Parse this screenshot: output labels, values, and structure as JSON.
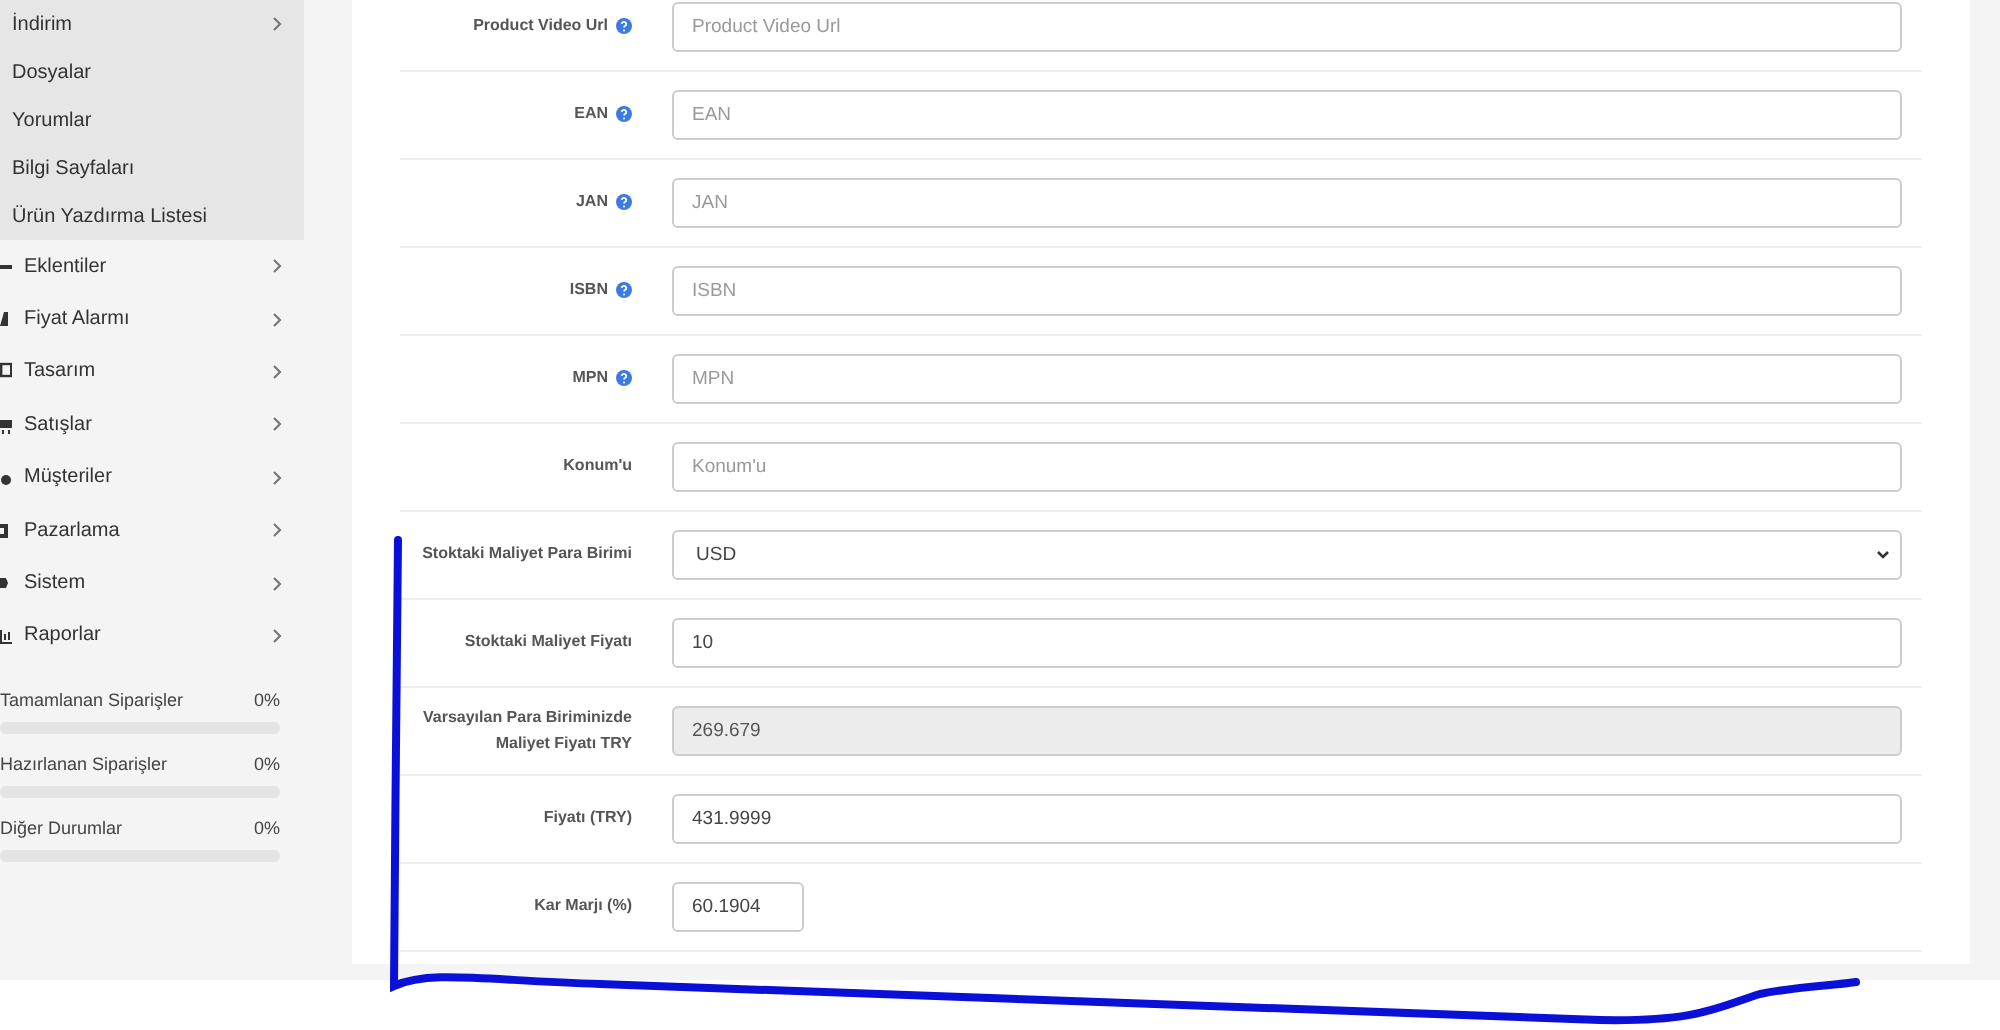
{
  "sidebar": {
    "submenu": [
      {
        "label": "İndirim",
        "has_arrow": true
      },
      {
        "label": "Dosyalar",
        "has_arrow": false
      },
      {
        "label": "Yorumlar",
        "has_arrow": false
      },
      {
        "label": "Bilgi Sayfaları",
        "has_arrow": false
      },
      {
        "label": "Ürün Yazdırma Listesi",
        "has_arrow": false
      }
    ],
    "menu": [
      {
        "label": "Eklentiler"
      },
      {
        "label": "Fiyat Alarmı"
      },
      {
        "label": "Tasarım"
      },
      {
        "label": "Satışlar"
      },
      {
        "label": "Müşteriler"
      },
      {
        "label": "Pazarlama"
      },
      {
        "label": "Sistem"
      },
      {
        "label": "Raporlar"
      }
    ],
    "stats": [
      {
        "label": "Tamamlanan Siparişler",
        "value": "0%",
        "level": 0
      },
      {
        "label": "Hazırlanan Siparişler",
        "value": "0%",
        "level": 0
      },
      {
        "label": "Diğer Durumlar",
        "value": "0%",
        "level": 0
      }
    ]
  },
  "form": {
    "rows": [
      {
        "label": "Product Video Url",
        "help": true,
        "kind": "input",
        "placeholder": "Product Video Url",
        "disabled": false
      },
      {
        "label": "EAN",
        "help": true,
        "kind": "input",
        "placeholder": "EAN",
        "disabled": false
      },
      {
        "label": "JAN",
        "help": true,
        "kind": "input",
        "placeholder": "JAN",
        "disabled": false
      },
      {
        "label": "ISBN",
        "help": true,
        "kind": "input",
        "placeholder": "ISBN",
        "disabled": false
      },
      {
        "label": "MPN",
        "help": true,
        "kind": "input",
        "placeholder": "MPN",
        "disabled": false
      },
      {
        "label": "Konum'u",
        "help": false,
        "kind": "input",
        "placeholder": "Konum'u",
        "disabled": false
      },
      {
        "label": "Stoktaki Maliyet Para Birimi",
        "help": false,
        "kind": "select",
        "value": "USD"
      },
      {
        "label": "Stoktaki Maliyet Fiyatı",
        "help": false,
        "kind": "input",
        "value": "10",
        "disabled": false
      },
      {
        "label": "Varsayılan Para Biriminizde Maliyet Fiyatı TRY",
        "help": false,
        "kind": "input",
        "value": "269.679",
        "disabled": true
      },
      {
        "label": "Fiyatı (TRY)",
        "help": false,
        "kind": "input",
        "value": "431.9999",
        "disabled": false
      },
      {
        "label": "Kar Marjı (%)",
        "help": false,
        "kind": "short",
        "value": "60.1904",
        "disabled": false
      }
    ]
  }
}
